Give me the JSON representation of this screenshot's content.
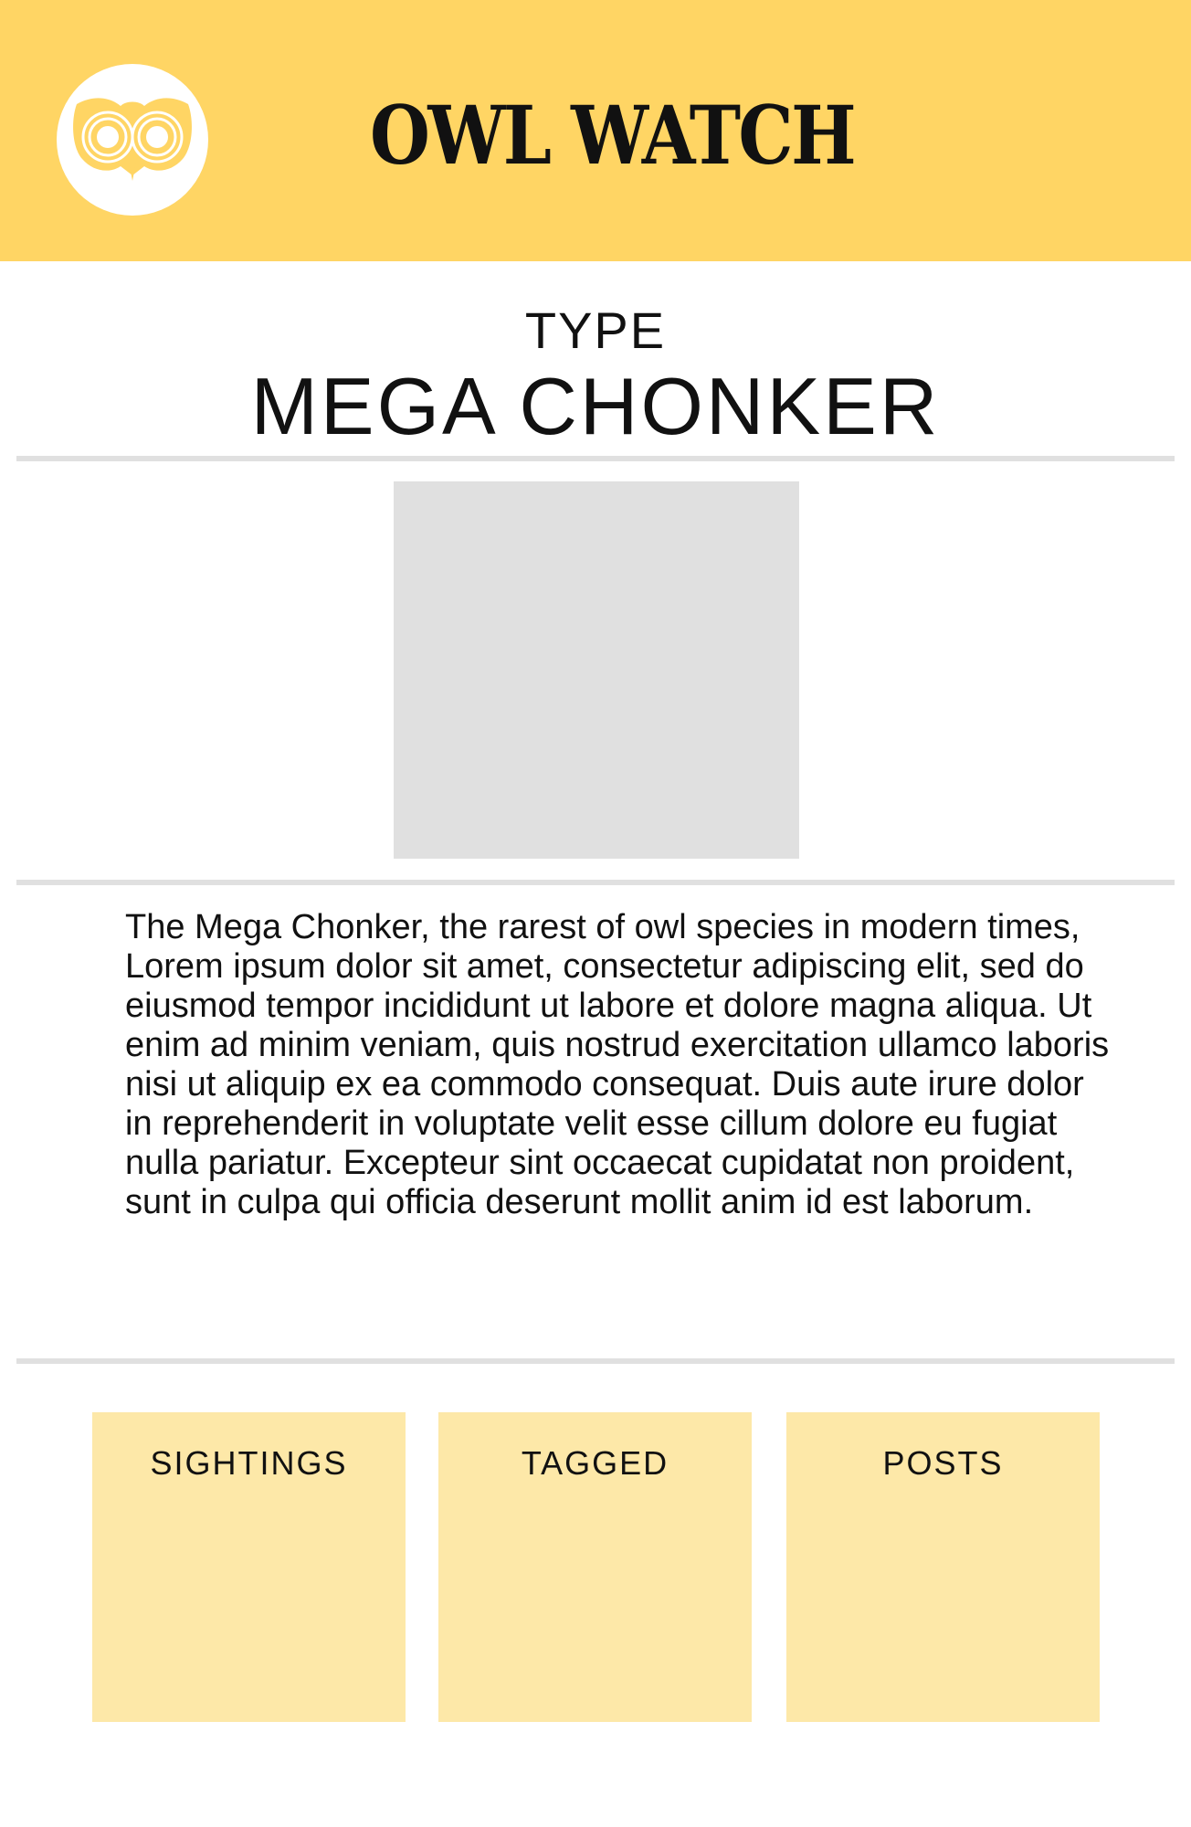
{
  "header": {
    "title": "OWL WATCH",
    "logo_icon": "owl-face-icon",
    "background_color": "#ffd564"
  },
  "type_section": {
    "label": "TYPE",
    "value": "MEGA CHONKER"
  },
  "description": "The Mega Chonker, the rarest of owl species in modern times, Lorem ipsum dolor sit amet, consectetur adipiscing elit, sed do eiusmod tempor incididunt ut labore et dolore magna aliqua. Ut enim ad minim veniam, quis nostrud exercitation ullamco laboris nisi ut aliquip ex ea commodo consequat. Duis aute irure dolor in reprehenderit in voluptate velit esse cillum dolore eu fugiat nulla pariatur. Excepteur sint occaecat cupidatat non proident, sunt in culpa qui officia deserunt mollit anim id est laborum.",
  "cards": [
    {
      "label": "SIGHTINGS"
    },
    {
      "label": "TAGGED"
    },
    {
      "label": "POSTS"
    }
  ],
  "colors": {
    "accent": "#ffd564",
    "card": "#fde8a8",
    "placeholder": "#e0e0e0"
  }
}
